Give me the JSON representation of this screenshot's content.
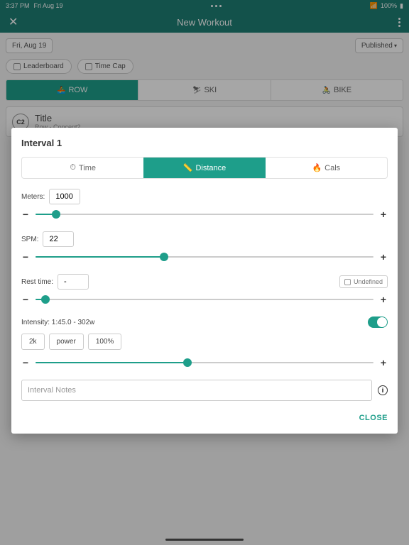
{
  "status": {
    "time": "3:37 PM",
    "date": "Fri Aug 19",
    "wifi": "100%"
  },
  "header": {
    "title": "New Workout"
  },
  "page": {
    "date_chip": "Fri, Aug 19",
    "published": "Published",
    "leaderboard": "Leaderboard",
    "timecap": "Time Cap",
    "tabs": {
      "row": "ROW",
      "ski": "SKI",
      "bike": "BIKE"
    },
    "card": {
      "badge": "C2",
      "title": "Title",
      "sub": "Row - Concept2"
    }
  },
  "modal": {
    "title": "Interval 1",
    "tabs": {
      "time": "Time",
      "distance": "Distance",
      "cals": "Cals"
    },
    "meters": {
      "label": "Meters:",
      "value": "1000",
      "pct": 6
    },
    "spm": {
      "label": "SPM:",
      "value": "22",
      "pct": 38
    },
    "rest": {
      "label": "Rest time:",
      "value": "-",
      "undefined": "Undefined",
      "pct": 3
    },
    "intensity": {
      "label": "Intensity: 1:45.0 - 302w",
      "pill_2k": "2k",
      "pill_power": "power",
      "pill_pct": "100%",
      "pct": 45
    },
    "notes_placeholder": "Interval Notes",
    "close": "CLOSE"
  }
}
